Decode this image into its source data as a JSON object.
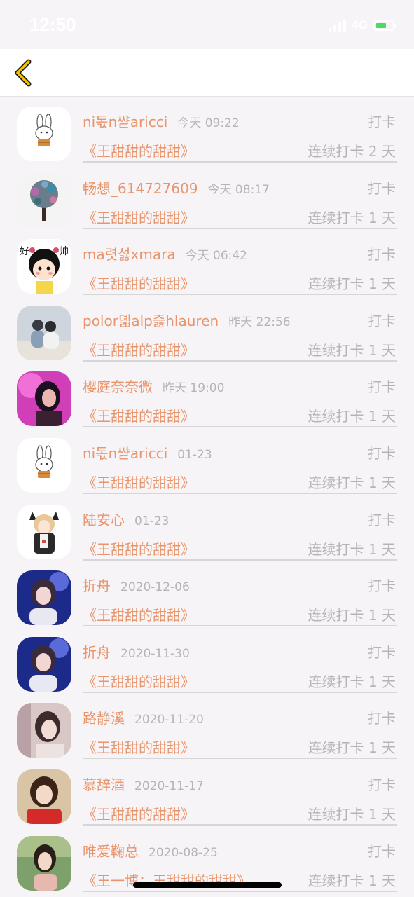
{
  "status_bar": {
    "time": "12:50",
    "network": "4G"
  },
  "nav": {
    "back_icon": "chevron-left-icon",
    "accent_color": "#f5c400"
  },
  "colors": {
    "name": "#e8956b",
    "muted": "#b5b5b5",
    "background": "#f7f4f8"
  },
  "records": [
    {
      "name": "ni돇n쌷aricci",
      "time": "今天 09:22",
      "action": "打卡",
      "group": "《王甜甜的甜甜》",
      "streak": "连续打卡 2 天",
      "avatar": "bunny"
    },
    {
      "name": "畅想_614727609",
      "time": "今天 08:17",
      "action": "打卡",
      "group": "《王甜甜的甜甜》",
      "streak": "连续打卡 1 天",
      "avatar": "tree"
    },
    {
      "name": "ma렷섫xmara",
      "time": "今天 06:42",
      "action": "打卡",
      "group": "《王甜甜的甜甜》",
      "streak": "连续打卡 1 天",
      "avatar": "cartoon-girl"
    },
    {
      "name": "polor뎳alp즗hlauren",
      "time": "昨天 22:56",
      "action": "打卡",
      "group": "《王甜甜的甜甜》",
      "streak": "连续打卡 1 天",
      "avatar": "couple"
    },
    {
      "name": "樱庭奈奈微",
      "time": "昨天 19:00",
      "action": "打卡",
      "group": "《王甜甜的甜甜》",
      "streak": "连续打卡 1 天",
      "avatar": "pink-portrait"
    },
    {
      "name": "ni돇n쌷aricci",
      "time": "01-23",
      "action": "打卡",
      "group": "《王甜甜的甜甜》",
      "streak": "连续打卡 1 天",
      "avatar": "bunny"
    },
    {
      "name": "陆安心",
      "time": "01-23",
      "action": "打卡",
      "group": "《王甜甜的甜甜》",
      "streak": "连续打卡 1 天",
      "avatar": "anime-girl"
    },
    {
      "name": "折舟",
      "time": "2020-12-06",
      "action": "打卡",
      "group": "《王甜甜的甜甜》",
      "streak": "连续打卡 1 天",
      "avatar": "blue-portrait"
    },
    {
      "name": "折舟",
      "time": "2020-11-30",
      "action": "打卡",
      "group": "《王甜甜的甜甜》",
      "streak": "连续打卡 1 天",
      "avatar": "blue-portrait"
    },
    {
      "name": "路静溪",
      "time": "2020-11-20",
      "action": "打卡",
      "group": "《王甜甜的甜甜》",
      "streak": "连续打卡 1 天",
      "avatar": "soft-portrait"
    },
    {
      "name": "慕辞酒",
      "time": "2020-11-17",
      "action": "打卡",
      "group": "《王甜甜的甜甜》",
      "streak": "连续打卡 1 天",
      "avatar": "red-portrait"
    },
    {
      "name": "唯爱鞠总",
      "time": "2020-08-25",
      "action": "打卡",
      "group": "《王一博：王甜甜的甜甜》",
      "streak": "连续打卡 1 天",
      "avatar": "outdoor-portrait"
    }
  ]
}
